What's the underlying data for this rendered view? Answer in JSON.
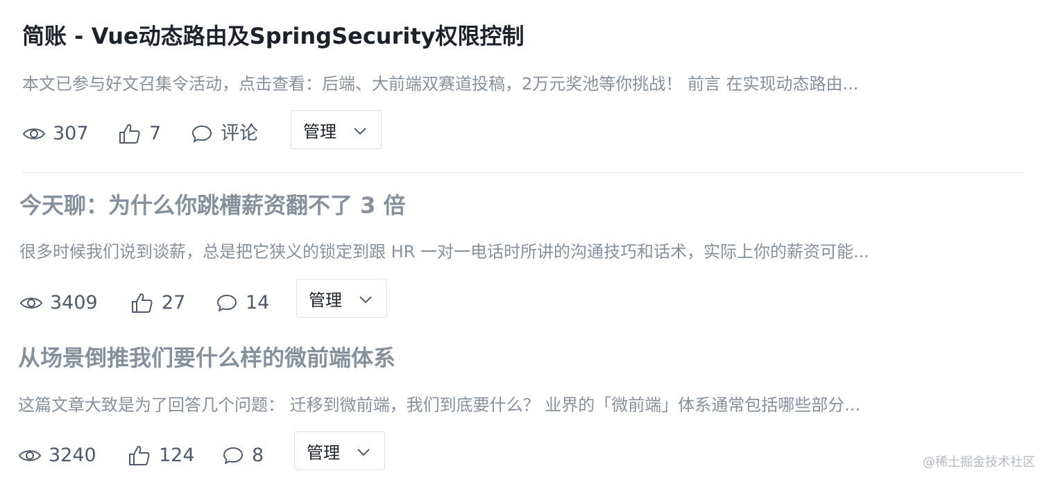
{
  "articles": [
    {
      "title": "简账 - Vue动态路由及SpringSecurity权限控制",
      "abstract": "本文已参与好文召集令活动，点击查看：后端、大前端双赛道投稿，2万元奖池等你挑战！ 前言 在实现动态路由...",
      "views": "307",
      "likes": "7",
      "comments": "评论",
      "manage_label": "管理"
    },
    {
      "title": "今天聊：为什么你跳槽薪资翻不了 3 倍",
      "abstract": "很多时候我们说到谈薪，总是把它狭义的锁定到跟 HR 一对一电话时所讲的沟通技巧和话术，实际上你的薪资可能...",
      "views": "3409",
      "likes": "27",
      "comments": "14",
      "manage_label": "管理"
    },
    {
      "title": "从场景倒推我们要什么样的微前端体系",
      "abstract": "这篇文章大致是为了回答几个问题： 迁移到微前端，我们到底要什么？ 业界的「微前端」体系通常包括哪些部分...",
      "views": "3240",
      "likes": "124",
      "comments": "8",
      "manage_label": "管理"
    }
  ],
  "watermark": "@稀土掘金技术社区",
  "icons": {
    "views": "eye-icon",
    "likes": "thumbs-up-icon",
    "comments": "comment-icon",
    "dropdown": "chevron-down-icon"
  },
  "colors": {
    "title_primary": "#1d2129",
    "title_muted": "#86909c",
    "abstract": "#86909c",
    "meta": "#4e5969",
    "divider": "#e5e6eb"
  }
}
